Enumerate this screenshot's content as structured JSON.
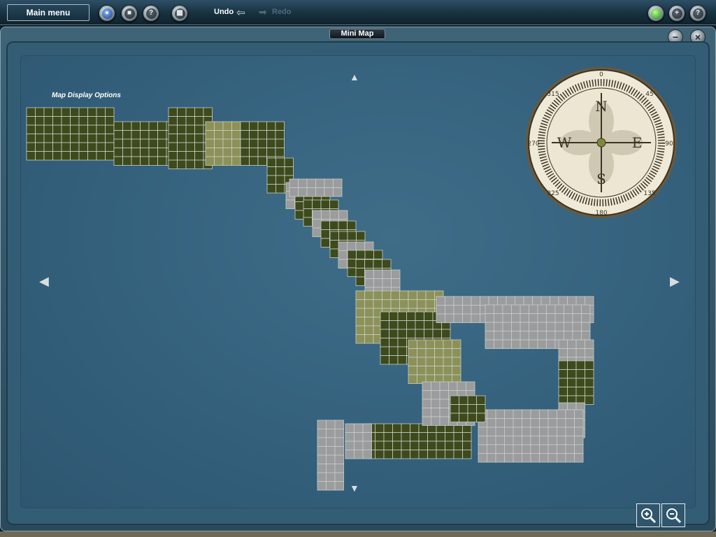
{
  "toolbar": {
    "main_menu_label": "Main menu",
    "undo_label": "Undo",
    "redo_label": "Redo"
  },
  "window": {
    "title": "Mini Map"
  },
  "map": {
    "display_options_label": "Map Display Options"
  },
  "compass": {
    "north": "N",
    "south": "S",
    "east": "E",
    "west": "W",
    "deg_0": "0",
    "deg_45": "45",
    "deg_90": "90",
    "deg_135": "135",
    "deg_180": "180",
    "deg_225": "225",
    "deg_270": "270",
    "deg_315": "315"
  },
  "icons": {
    "main": "globe-icon",
    "stop": "stop-icon",
    "tools": "tools-icon",
    "grid": "grid-icon",
    "status": "green-light-icon",
    "add": "plus-icon",
    "help": "question-icon",
    "minimize": "minimize-icon",
    "close": "close-icon",
    "zoom_in": "zoom-in-icon",
    "zoom_out": "zoom-out-icon"
  },
  "colors": {
    "water": "#335f7b",
    "forest_tile": "#3d4a1c",
    "grass_tile": "#8b9158",
    "urban_tile": "#9a9c9e"
  }
}
